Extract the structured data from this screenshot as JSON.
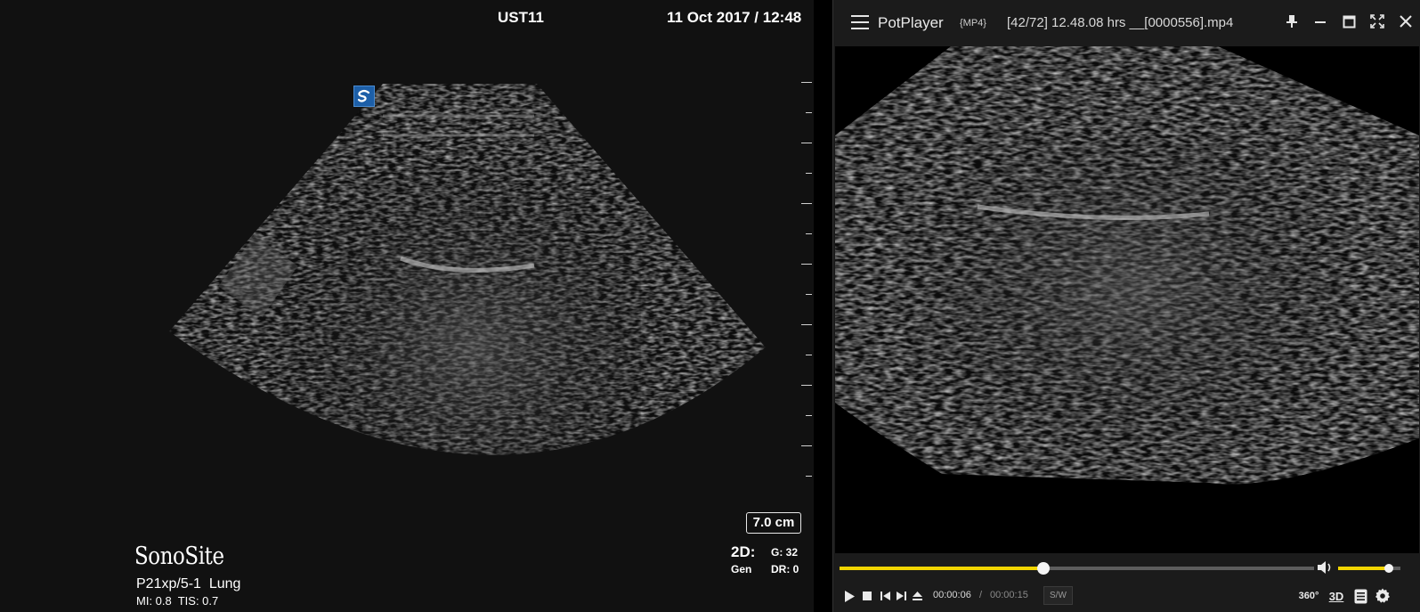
{
  "ultrasound": {
    "study_id": "UST11",
    "datetime": "11 Oct 2017 / 12:48",
    "depth": "7.0 cm",
    "brand": "SonoSite",
    "probe_preset": "P21xp/5-1  Lung",
    "safety": "MI: 0.8  TIS: 0.7",
    "mode": "2D:",
    "preset": "Gen",
    "gain": "G: 32",
    "dynamic_range": "DR: 0",
    "logo_icon": "sonosite-s-logo-icon",
    "depth_tick_count": 14
  },
  "player": {
    "app_name": "PotPlayer",
    "format": "{MP4}",
    "file_title": "[42/72] 12.48.08 hrs __[0000556].mp4",
    "window_buttons": [
      "pin-icon",
      "minimize-icon",
      "maximize-icon",
      "fullscreen-icon",
      "close-icon"
    ],
    "progress_fraction": 0.43,
    "volume_fraction": 0.82,
    "time_current": "00:00:06",
    "time_separator": "/",
    "time_total": "00:00:15",
    "sw_label": "S/W",
    "btn_360_label": "360°",
    "btn_3d_label": "3D",
    "accent_color": "#f1d500"
  }
}
